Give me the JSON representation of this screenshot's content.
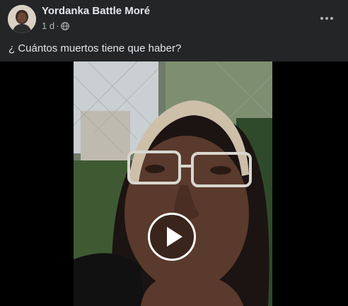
{
  "post": {
    "author": "Yordanka Battle Moré",
    "time": "1 d",
    "separator": "·",
    "audience_icon": "globe-icon",
    "more_icon": "ellipsis-icon",
    "caption": "¿ Cuántos muertos tiene que haber?"
  },
  "video": {
    "play_icon": "play-icon"
  },
  "colors": {
    "background": "#242526",
    "primary_text": "#e4e6eb",
    "secondary_text": "#b0b3b8"
  }
}
